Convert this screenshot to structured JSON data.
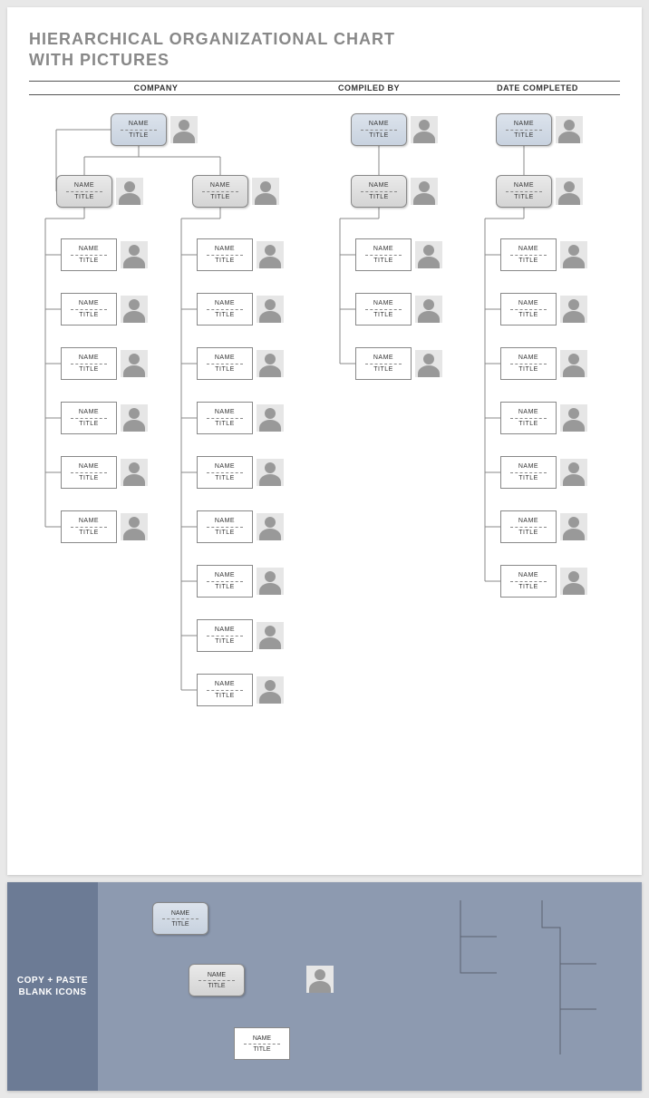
{
  "title_line1": "HIERARCHICAL ORGANIZATIONAL CHART",
  "title_line2": "WITH PICTURES",
  "headers": {
    "company": "COMPANY",
    "compiled_by": "COMPILED BY",
    "date_completed": "DATE COMPLETED"
  },
  "field": {
    "name": "NAME",
    "title": "TITLE"
  },
  "palette_label": "COPY + PASTE BLANK ICONS",
  "chart_data": {
    "type": "tree",
    "title": "Hierarchical Organizational Chart With Pictures",
    "metadata_fields": [
      "COMPANY",
      "COMPILED BY",
      "DATE COMPLETED"
    ],
    "trees": [
      {
        "root": {
          "name": "NAME",
          "title": "TITLE",
          "level": "top",
          "children": [
            {
              "name": "NAME",
              "title": "TITLE",
              "level": "mid",
              "children": [
                {
                  "name": "NAME",
                  "title": "TITLE"
                },
                {
                  "name": "NAME",
                  "title": "TITLE"
                },
                {
                  "name": "NAME",
                  "title": "TITLE"
                },
                {
                  "name": "NAME",
                  "title": "TITLE"
                },
                {
                  "name": "NAME",
                  "title": "TITLE"
                },
                {
                  "name": "NAME",
                  "title": "TITLE"
                }
              ]
            },
            {
              "name": "NAME",
              "title": "TITLE",
              "level": "mid",
              "children": [
                {
                  "name": "NAME",
                  "title": "TITLE"
                },
                {
                  "name": "NAME",
                  "title": "TITLE"
                },
                {
                  "name": "NAME",
                  "title": "TITLE"
                },
                {
                  "name": "NAME",
                  "title": "TITLE"
                },
                {
                  "name": "NAME",
                  "title": "TITLE"
                },
                {
                  "name": "NAME",
                  "title": "TITLE"
                },
                {
                  "name": "NAME",
                  "title": "TITLE"
                },
                {
                  "name": "NAME",
                  "title": "TITLE"
                },
                {
                  "name": "NAME",
                  "title": "TITLE"
                }
              ]
            }
          ]
        }
      },
      {
        "root": {
          "name": "NAME",
          "title": "TITLE",
          "level": "top",
          "children": [
            {
              "name": "NAME",
              "title": "TITLE",
              "level": "mid",
              "children": [
                {
                  "name": "NAME",
                  "title": "TITLE"
                },
                {
                  "name": "NAME",
                  "title": "TITLE"
                },
                {
                  "name": "NAME",
                  "title": "TITLE"
                }
              ]
            }
          ]
        }
      },
      {
        "root": {
          "name": "NAME",
          "title": "TITLE",
          "level": "top",
          "children": [
            {
              "name": "NAME",
              "title": "TITLE",
              "level": "mid",
              "children": [
                {
                  "name": "NAME",
                  "title": "TITLE"
                },
                {
                  "name": "NAME",
                  "title": "TITLE"
                },
                {
                  "name": "NAME",
                  "title": "TITLE"
                },
                {
                  "name": "NAME",
                  "title": "TITLE"
                },
                {
                  "name": "NAME",
                  "title": "TITLE"
                },
                {
                  "name": "NAME",
                  "title": "TITLE"
                },
                {
                  "name": "NAME",
                  "title": "TITLE"
                }
              ]
            }
          ]
        }
      }
    ],
    "palette_items": [
      "top-level-card",
      "mid-level-card",
      "leaf-card",
      "avatar-placeholder",
      "connector-lines"
    ]
  }
}
